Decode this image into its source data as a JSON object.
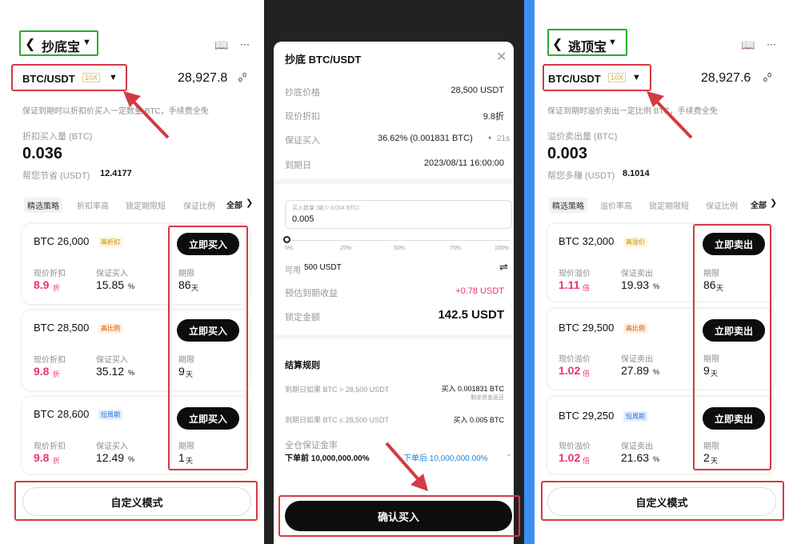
{
  "left": {
    "title": "抄底宝",
    "pair": "BTC/USDT",
    "leverage": "10X",
    "price": "28,927.8",
    "desc": "保证到期时以折扣价买入一定数量 BTC，手续费全免",
    "amount_label": "折扣买入量 (BTC)",
    "amount": "0.036",
    "save_label": "帮您节省 (USDT)",
    "save_value": "12.4177",
    "tabs": [
      "精选策略",
      "折扣率高",
      "锁定期限短",
      "保证比例",
      "全部"
    ],
    "cards": [
      {
        "price": "BTC 26,000",
        "badge": "高折扣",
        "l1": "现价折扣",
        "v1": "8.9",
        "u1": "折",
        "l2": "保证买入",
        "v2": "15.85",
        "u2": "%",
        "l3": "期限",
        "v3": "86",
        "u3": "天",
        "btn": "立即买入"
      },
      {
        "price": "BTC 28,500",
        "badge": "高比例",
        "l1": "现价折扣",
        "v1": "9.8",
        "u1": "折",
        "l2": "保证买入",
        "v2": "35.12",
        "u2": "%",
        "l3": "期限",
        "v3": "9",
        "u3": "天",
        "btn": "立即买入"
      },
      {
        "price": "BTC 28,600",
        "badge": "短周期",
        "l1": "现价折扣",
        "v1": "9.8",
        "u1": "折",
        "l2": "保证买入",
        "v2": "12.49",
        "u2": "%",
        "l3": "期限",
        "v3": "1",
        "u3": "天",
        "btn": "立即买入"
      }
    ],
    "custom": "自定义模式"
  },
  "middle": {
    "title": "抄底 BTC/USDT",
    "rows": [
      {
        "label": "抄底价格",
        "value": "28,500 USDT"
      },
      {
        "label": "现价折扣",
        "value": "9.8折"
      },
      {
        "label": "保证买入",
        "value": "36.62% (0.001831 BTC)",
        "extra": "21s"
      },
      {
        "label": "到期日",
        "value": "2023/08/11 16:00:00"
      }
    ],
    "input_label": "买入数量 (最少 0.004 BTC)",
    "input_value": "0.005",
    "slider_ticks": [
      "0%",
      "25%",
      "50%",
      "75%",
      "100%"
    ],
    "available_label": "可用",
    "available": "500 USDT",
    "est_label": "预估到期收益",
    "est_value": "+0.78 USDT",
    "lock_label": "锁定金额",
    "lock_value": "142.5 USDT",
    "rules_title": "结算规则",
    "rule1_l": "到期日如果 BTC > 28,500 USDT",
    "rule1_r": "买入 0.001831 BTC",
    "rule1_sub": "剩余资金返还",
    "rule2_l": "到期日如果 BTC ≤ 28,500 USDT",
    "rule2_r": "买入 0.005 BTC",
    "margin_label": "全仓保证金率",
    "margin_before": "下单前 10,000,000.00%",
    "margin_after": "下单后 10,000,000.00%",
    "confirm": "确认买入"
  },
  "right": {
    "title": "逃顶宝",
    "pair": "BTC/USDT",
    "leverage": "10X",
    "price": "28,927.6",
    "desc": "保证到期时溢价卖出一定比例 BTC，手续费全免",
    "amount_label": "溢价卖出量 (BTC)",
    "amount": "0.003",
    "earn_label": "帮您多赚 (USDT)",
    "earn_value": "8.1014",
    "tabs": [
      "精选策略",
      "溢价率高",
      "锁定期限短",
      "保证比例",
      "全部"
    ],
    "cards": [
      {
        "price": "BTC 32,000",
        "badge": "高溢价",
        "l1": "现价溢价",
        "v1": "1.11",
        "u1": "倍",
        "l2": "保证卖出",
        "v2": "19.93",
        "u2": "%",
        "l3": "期限",
        "v3": "86",
        "u3": "天",
        "btn": "立即卖出"
      },
      {
        "price": "BTC 29,500",
        "badge": "高比例",
        "l1": "现价溢价",
        "v1": "1.02",
        "u1": "倍",
        "l2": "保证卖出",
        "v2": "27.89",
        "u2": "%",
        "l3": "期限",
        "v3": "9",
        "u3": "天",
        "btn": "立即卖出"
      },
      {
        "price": "BTC 29,250",
        "badge": "短周期",
        "l1": "现价溢价",
        "v1": "1.02",
        "u1": "倍",
        "l2": "保证卖出",
        "v2": "21.63",
        "u2": "%",
        "l3": "期限",
        "v3": "2",
        "u3": "天",
        "btn": "立即卖出"
      }
    ],
    "custom": "自定义模式"
  },
  "icons": {
    "back": "chevron-left-icon",
    "dropdown": "caret-down-icon",
    "book": "book-icon",
    "more": "more-icon",
    "kline": "chart-icon",
    "close": "close-icon",
    "swap": "swap-icon"
  },
  "colors": {
    "accent_red": "#e8356a",
    "highlight_box": "#d33a43",
    "green_box": "#2cae2e",
    "link_blue": "#1f86d6",
    "divider": "#3b8ff0"
  }
}
